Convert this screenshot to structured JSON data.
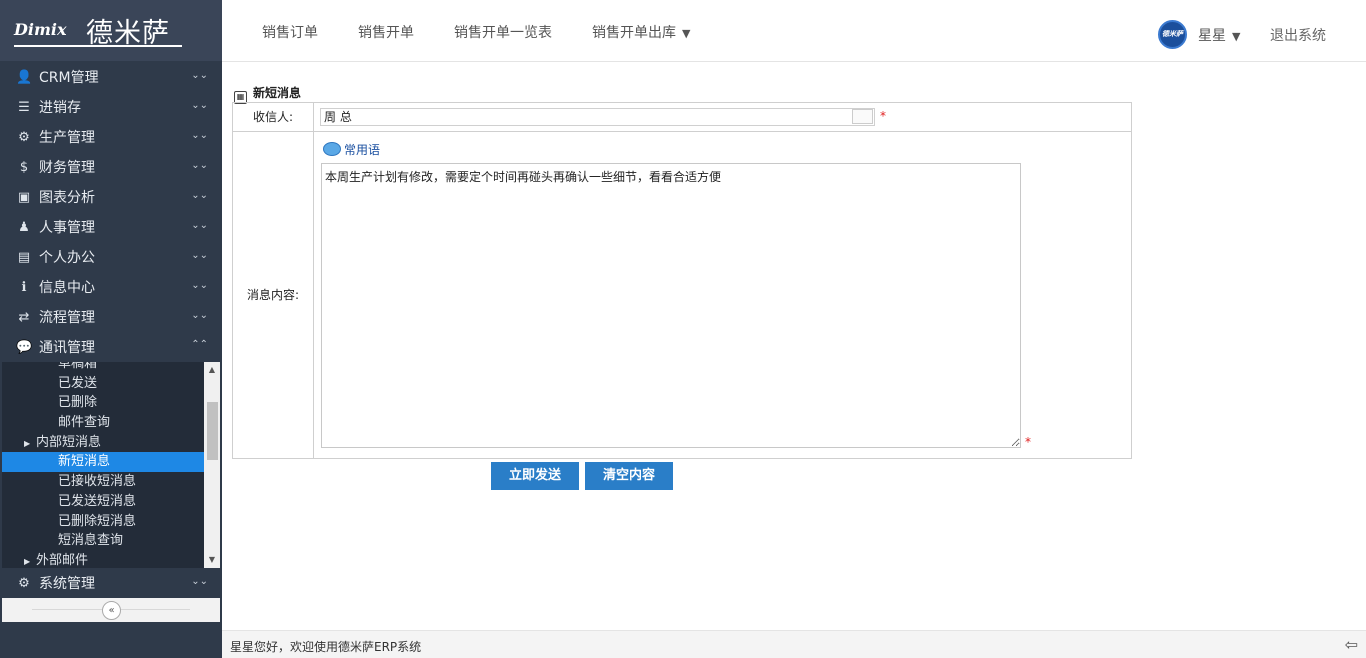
{
  "logo": {
    "en": "Dimix",
    "cn": "德米萨"
  },
  "sidebar": {
    "items": [
      {
        "label": "CRM管理",
        "icon": "user-icon",
        "glyph": "👤"
      },
      {
        "label": "进销存",
        "icon": "list-icon",
        "glyph": "☰"
      },
      {
        "label": "生产管理",
        "icon": "gears-icon",
        "glyph": "⚙"
      },
      {
        "label": "财务管理",
        "icon": "dollar-icon",
        "glyph": "$"
      },
      {
        "label": "图表分析",
        "icon": "image-icon",
        "glyph": "▣"
      },
      {
        "label": "人事管理",
        "icon": "people-icon",
        "glyph": "♟"
      },
      {
        "label": "个人办公",
        "icon": "briefcase-icon",
        "glyph": "▤"
      },
      {
        "label": "信息中心",
        "icon": "info-icon",
        "glyph": "ℹ"
      },
      {
        "label": "流程管理",
        "icon": "exchange-icon",
        "glyph": "⇄"
      },
      {
        "label": "通讯管理",
        "icon": "chat-icon",
        "glyph": "💬"
      }
    ],
    "submenu": [
      {
        "label": "草稿箱",
        "type": "leaf"
      },
      {
        "label": "已发送",
        "type": "leaf"
      },
      {
        "label": "已删除",
        "type": "leaf"
      },
      {
        "label": "邮件查询",
        "type": "leaf"
      },
      {
        "label": "内部短消息",
        "type": "group"
      },
      {
        "label": "新短消息",
        "type": "selected"
      },
      {
        "label": "已接收短消息",
        "type": "leaf"
      },
      {
        "label": "已发送短消息",
        "type": "leaf"
      },
      {
        "label": "已删除短消息",
        "type": "leaf"
      },
      {
        "label": "短消息查询",
        "type": "leaf"
      },
      {
        "label": "外部邮件",
        "type": "group"
      }
    ],
    "system": {
      "label": "系统管理",
      "icon": "gear-icon",
      "glyph": "⚙"
    }
  },
  "topnav": {
    "links": [
      "销售订单",
      "销售开单",
      "销售开单一览表",
      "销售开单出库"
    ],
    "avatar_text": "德米萨",
    "user": "星星",
    "logout": "退出系统"
  },
  "form": {
    "title": "新短消息",
    "recipient_label": "收信人:",
    "recipient_value": "周 总",
    "required_mark": "*",
    "content_label": "消息内容:",
    "phrases_link": "常用语",
    "message": "本周生产计划有修改，需要定个时间再碰头再确认一些细节，看看合适方便",
    "send_label": "立即发送",
    "clear_label": "清空内容"
  },
  "footer": {
    "text": "星星您好，欢迎使用德米萨ERP系统"
  },
  "colors": {
    "sidebar": "#2f3a4a",
    "accent": "#2a7ec8",
    "selected": "#1e88e5"
  }
}
